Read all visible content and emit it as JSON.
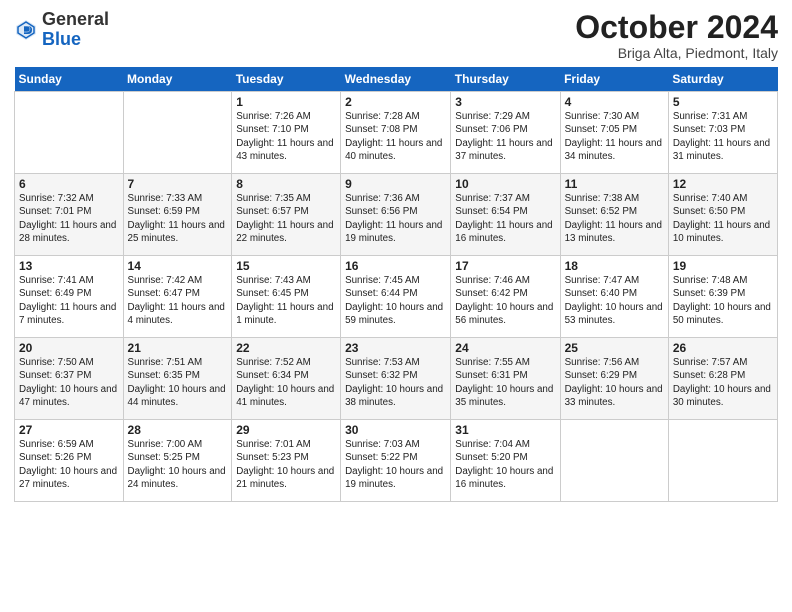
{
  "header": {
    "logo_general": "General",
    "logo_blue": "Blue",
    "month_title": "October 2024",
    "location": "Briga Alta, Piedmont, Italy"
  },
  "weekdays": [
    "Sunday",
    "Monday",
    "Tuesday",
    "Wednesday",
    "Thursday",
    "Friday",
    "Saturday"
  ],
  "weeks": [
    [
      {
        "day": "",
        "info": ""
      },
      {
        "day": "",
        "info": ""
      },
      {
        "day": "1",
        "info": "Sunrise: 7:26 AM\nSunset: 7:10 PM\nDaylight: 11 hours and 43 minutes."
      },
      {
        "day": "2",
        "info": "Sunrise: 7:28 AM\nSunset: 7:08 PM\nDaylight: 11 hours and 40 minutes."
      },
      {
        "day": "3",
        "info": "Sunrise: 7:29 AM\nSunset: 7:06 PM\nDaylight: 11 hours and 37 minutes."
      },
      {
        "day": "4",
        "info": "Sunrise: 7:30 AM\nSunset: 7:05 PM\nDaylight: 11 hours and 34 minutes."
      },
      {
        "day": "5",
        "info": "Sunrise: 7:31 AM\nSunset: 7:03 PM\nDaylight: 11 hours and 31 minutes."
      }
    ],
    [
      {
        "day": "6",
        "info": "Sunrise: 7:32 AM\nSunset: 7:01 PM\nDaylight: 11 hours and 28 minutes."
      },
      {
        "day": "7",
        "info": "Sunrise: 7:33 AM\nSunset: 6:59 PM\nDaylight: 11 hours and 25 minutes."
      },
      {
        "day": "8",
        "info": "Sunrise: 7:35 AM\nSunset: 6:57 PM\nDaylight: 11 hours and 22 minutes."
      },
      {
        "day": "9",
        "info": "Sunrise: 7:36 AM\nSunset: 6:56 PM\nDaylight: 11 hours and 19 minutes."
      },
      {
        "day": "10",
        "info": "Sunrise: 7:37 AM\nSunset: 6:54 PM\nDaylight: 11 hours and 16 minutes."
      },
      {
        "day": "11",
        "info": "Sunrise: 7:38 AM\nSunset: 6:52 PM\nDaylight: 11 hours and 13 minutes."
      },
      {
        "day": "12",
        "info": "Sunrise: 7:40 AM\nSunset: 6:50 PM\nDaylight: 11 hours and 10 minutes."
      }
    ],
    [
      {
        "day": "13",
        "info": "Sunrise: 7:41 AM\nSunset: 6:49 PM\nDaylight: 11 hours and 7 minutes."
      },
      {
        "day": "14",
        "info": "Sunrise: 7:42 AM\nSunset: 6:47 PM\nDaylight: 11 hours and 4 minutes."
      },
      {
        "day": "15",
        "info": "Sunrise: 7:43 AM\nSunset: 6:45 PM\nDaylight: 11 hours and 1 minute."
      },
      {
        "day": "16",
        "info": "Sunrise: 7:45 AM\nSunset: 6:44 PM\nDaylight: 10 hours and 59 minutes."
      },
      {
        "day": "17",
        "info": "Sunrise: 7:46 AM\nSunset: 6:42 PM\nDaylight: 10 hours and 56 minutes."
      },
      {
        "day": "18",
        "info": "Sunrise: 7:47 AM\nSunset: 6:40 PM\nDaylight: 10 hours and 53 minutes."
      },
      {
        "day": "19",
        "info": "Sunrise: 7:48 AM\nSunset: 6:39 PM\nDaylight: 10 hours and 50 minutes."
      }
    ],
    [
      {
        "day": "20",
        "info": "Sunrise: 7:50 AM\nSunset: 6:37 PM\nDaylight: 10 hours and 47 minutes."
      },
      {
        "day": "21",
        "info": "Sunrise: 7:51 AM\nSunset: 6:35 PM\nDaylight: 10 hours and 44 minutes."
      },
      {
        "day": "22",
        "info": "Sunrise: 7:52 AM\nSunset: 6:34 PM\nDaylight: 10 hours and 41 minutes."
      },
      {
        "day": "23",
        "info": "Sunrise: 7:53 AM\nSunset: 6:32 PM\nDaylight: 10 hours and 38 minutes."
      },
      {
        "day": "24",
        "info": "Sunrise: 7:55 AM\nSunset: 6:31 PM\nDaylight: 10 hours and 35 minutes."
      },
      {
        "day": "25",
        "info": "Sunrise: 7:56 AM\nSunset: 6:29 PM\nDaylight: 10 hours and 33 minutes."
      },
      {
        "day": "26",
        "info": "Sunrise: 7:57 AM\nSunset: 6:28 PM\nDaylight: 10 hours and 30 minutes."
      }
    ],
    [
      {
        "day": "27",
        "info": "Sunrise: 6:59 AM\nSunset: 5:26 PM\nDaylight: 10 hours and 27 minutes."
      },
      {
        "day": "28",
        "info": "Sunrise: 7:00 AM\nSunset: 5:25 PM\nDaylight: 10 hours and 24 minutes."
      },
      {
        "day": "29",
        "info": "Sunrise: 7:01 AM\nSunset: 5:23 PM\nDaylight: 10 hours and 21 minutes."
      },
      {
        "day": "30",
        "info": "Sunrise: 7:03 AM\nSunset: 5:22 PM\nDaylight: 10 hours and 19 minutes."
      },
      {
        "day": "31",
        "info": "Sunrise: 7:04 AM\nSunset: 5:20 PM\nDaylight: 10 hours and 16 minutes."
      },
      {
        "day": "",
        "info": ""
      },
      {
        "day": "",
        "info": ""
      }
    ]
  ]
}
